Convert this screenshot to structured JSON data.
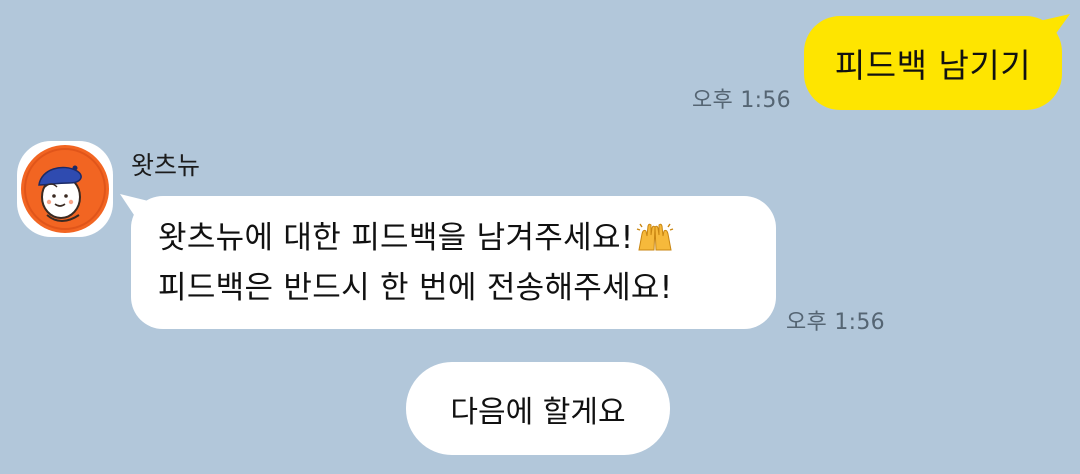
{
  "chat": {
    "outgoing": {
      "text": "피드백 남기기",
      "time": "오후 1:56"
    },
    "incoming": {
      "sender": "왓츠뉴",
      "avatar_icon": "orange-character-avatar",
      "lines": [
        "왓츠뉴에 대한 피드백을 남겨주세요!",
        "피드백은 반드시 한 번에 전송해주세요!"
      ],
      "emoji_icon": "raising-hands-emoji",
      "time": "오후 1:56"
    },
    "quick_reply": {
      "label": "다음에 할게요"
    }
  },
  "colors": {
    "background": "#b2c7da",
    "outgoing_bubble": "#fee500",
    "incoming_bubble": "#ffffff",
    "avatar_orange": "#f26522",
    "timestamp": "#556573"
  }
}
